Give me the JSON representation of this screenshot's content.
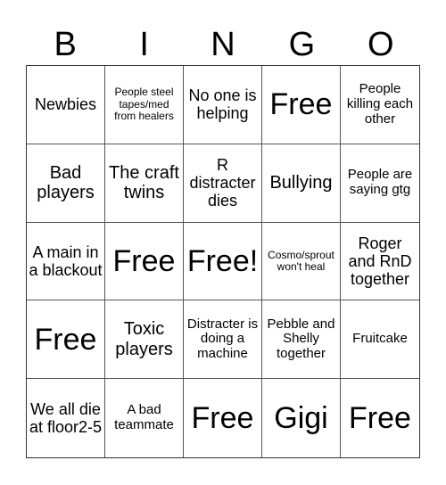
{
  "header": {
    "letters": [
      "B",
      "I",
      "N",
      "G",
      "O"
    ]
  },
  "cells": [
    "Newbies",
    "People steel tapes/med from healers",
    "No one is helping",
    "Free",
    "People killing each other",
    "Bad players",
    "The craft twins",
    "R distracter dies",
    "Bullying",
    "People are saying gtg",
    "A main in a blackout",
    "Free",
    "Free!",
    "Cosmo/sprout won't heal",
    "Roger and RnD together",
    "Free",
    "Toxic players",
    "Distracter is doing a machine",
    "Pebble and Shelly together",
    "Fruitcake",
    "We all die at floor2-5",
    "A bad teammate",
    "Free",
    "Gigi",
    "Free"
  ]
}
